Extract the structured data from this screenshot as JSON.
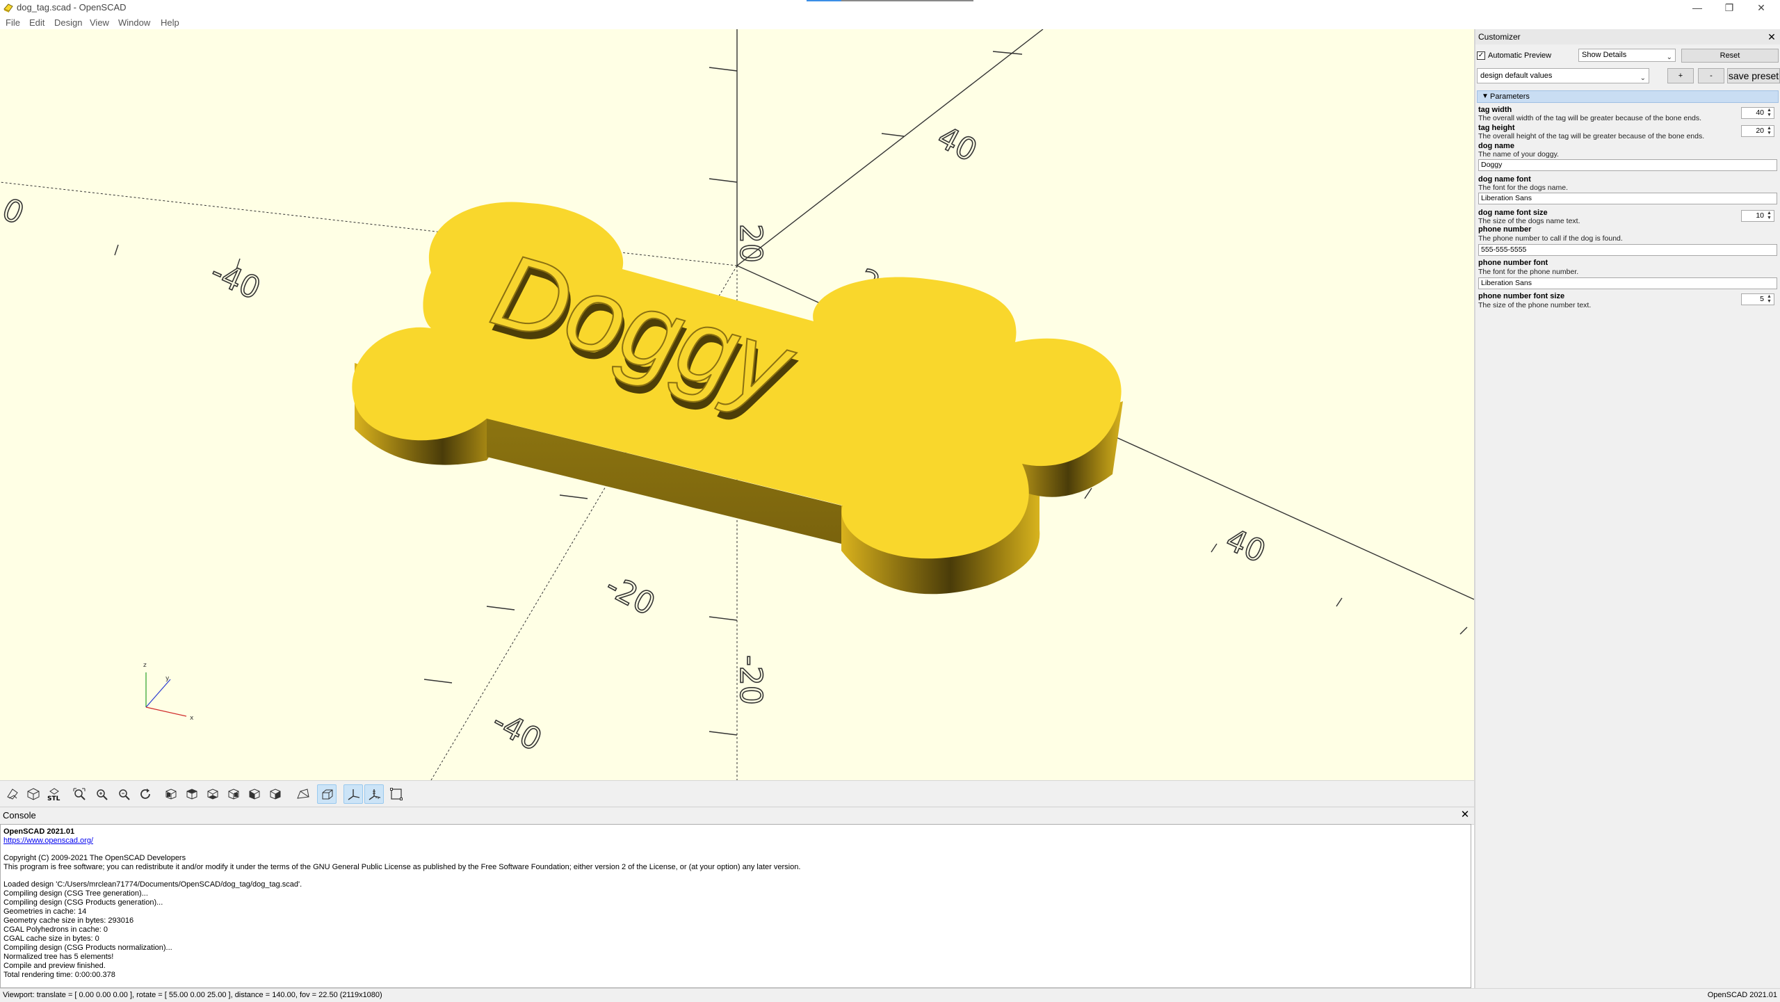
{
  "window": {
    "title": "dog_tag.scad - OpenSCAD",
    "minimize": "—",
    "restore": "❐",
    "close": "✕"
  },
  "menu": {
    "items": [
      {
        "label": "File"
      },
      {
        "label": "Edit"
      },
      {
        "label": "Design"
      },
      {
        "label": "View"
      },
      {
        "label": "Window"
      },
      {
        "label": "Help"
      }
    ]
  },
  "viewport": {
    "model_text": "Doggy",
    "model_color": "#f9d72c",
    "background_color": "#ffffe5",
    "axis_labels": [
      "20",
      "40",
      "-40",
      "20",
      "-20",
      "40",
      "-20",
      "-40"
    ],
    "gizmo": {
      "x": "x",
      "y": "y",
      "z": "z"
    }
  },
  "view_toolbar": {
    "buttons": [
      {
        "icon": "preview-icon"
      },
      {
        "icon": "render-icon"
      },
      {
        "icon": "export-stl-icon",
        "label": "STL"
      },
      {
        "icon": "view-all-icon"
      },
      {
        "icon": "zoom-in-icon"
      },
      {
        "icon": "zoom-out-icon"
      },
      {
        "icon": "reset-view-icon"
      },
      {
        "icon": "view-right-icon"
      },
      {
        "icon": "view-top-icon"
      },
      {
        "icon": "view-bottom-icon"
      },
      {
        "icon": "view-left-icon"
      },
      {
        "icon": "view-front-icon"
      },
      {
        "icon": "view-back-icon"
      },
      {
        "icon": "perspective-icon"
      },
      {
        "icon": "orthogonal-icon",
        "active": true
      },
      {
        "icon": "show-axes-icon",
        "active": true
      },
      {
        "icon": "show-scale-markers-icon",
        "active": true
      },
      {
        "icon": "show-edges-icon"
      }
    ]
  },
  "console": {
    "title": "Console",
    "close": "✕",
    "version": "OpenSCAD 2021.01",
    "link": "https://www.openscad.org/",
    "copyright": "Copyright (C) 2009-2021 The OpenSCAD Developers",
    "license": "This program is free software; you can redistribute it and/or modify it under the terms of the GNU General Public License as published by the Free Software Foundation; either version 2 of the License, or (at your option) any later version.",
    "log": [
      "Loaded design 'C:/Users/mrclean71774/Documents/OpenSCAD/dog_tag/dog_tag.scad'.",
      "Compiling design (CSG Tree generation)...",
      "Compiling design (CSG Products generation)...",
      "Geometries in cache: 14",
      "Geometry cache size in bytes: 293016",
      "CGAL Polyhedrons in cache: 0",
      "CGAL cache size in bytes: 0",
      "Compiling design (CSG Products normalization)...",
      "Normalized tree has 5 elements!",
      "Compile and preview finished.",
      "Total rendering time: 0:00:00.378"
    ]
  },
  "statusbar": {
    "viewport_info": "Viewport: translate = [ 0.00 0.00 0.00 ], rotate = [ 55.00 0.00 25.00 ], distance = 140.00, fov = 22.50 (2119x1080)",
    "version": "OpenSCAD 2021.01"
  },
  "customizer": {
    "title": "Customizer",
    "close": "✕",
    "auto_preview_label": "Automatic Preview",
    "auto_preview_checked": "✓",
    "details_select": "Show Details",
    "reset_label": "Reset",
    "preset_select": "design default values",
    "add_preset": "+",
    "remove_preset": "-",
    "save_preset": "save preset",
    "params_section": "Parameters",
    "params": {
      "tag_width": {
        "name": "tag width",
        "desc": "The overall width of the tag will be greater because of the bone ends.",
        "value": "40"
      },
      "tag_height": {
        "name": "tag height",
        "desc": "The overall height of the tag will be greater because of the bone ends.",
        "value": "20"
      },
      "dog_name": {
        "name": "dog name",
        "desc": "The name of your doggy.",
        "value": "Doggy"
      },
      "dog_name_font": {
        "name": "dog name font",
        "desc": "The font for the dogs name.",
        "value": "Liberation Sans"
      },
      "dog_name_font_size": {
        "name": "dog name font size",
        "desc": "The size of the dogs name text.",
        "value": "10"
      },
      "phone_number": {
        "name": "phone number",
        "desc": "The phone number to call if the dog is found.",
        "value": "555-555-5555"
      },
      "phone_number_font": {
        "name": "phone number font",
        "desc": "The font for the phone number.",
        "value": "Liberation Sans"
      },
      "phone_number_font_size": {
        "name": "phone number font size",
        "desc": "The size of the phone number text.",
        "value": "5"
      }
    }
  }
}
